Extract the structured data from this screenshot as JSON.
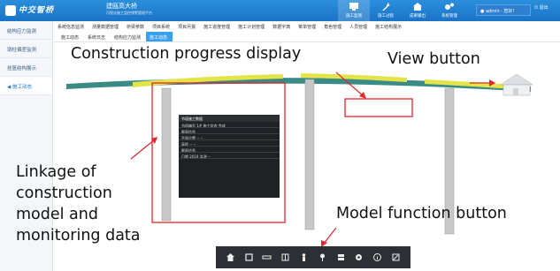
{
  "header": {
    "logo_text": "中交智桥",
    "title": "建瓯高大桥",
    "subtitle": "可视化施工监控预警管理平台",
    "nav": [
      {
        "label": "施工监测",
        "icon": "monitor-icon",
        "active": true
      },
      {
        "label": "施工过程",
        "icon": "wrench-icon",
        "active": false
      },
      {
        "label": "成果输出",
        "icon": "house-icon",
        "active": false
      },
      {
        "label": "系统管理",
        "icon": "gears-icon",
        "active": false
      }
    ],
    "user": "admin · 您好!",
    "exit": "退出"
  },
  "sidebar": {
    "items": [
      {
        "label": "结构应力监测",
        "active": false
      },
      {
        "label": "墩柱偏差监测",
        "active": false
      },
      {
        "label": "挂篮结构展示",
        "active": false
      },
      {
        "label": "◀ 施工动态",
        "active": true
      }
    ]
  },
  "menubar": {
    "items": [
      "系统信息监测",
      "测量数据管理",
      "桥梁参数",
      "项目系统",
      "项目月报",
      "施工进度管理",
      "施工计划管理",
      "数据字典",
      "菜单管理",
      "角色管理",
      "人员管理",
      "施工结构展示"
    ]
  },
  "tabs": [
    {
      "label": "施工动态",
      "active": false
    },
    {
      "label": "系统日志",
      "active": false
    },
    {
      "label": "结构应力监测",
      "active": false
    },
    {
      "label": "施工动态",
      "active": true
    }
  ],
  "annotations": {
    "progress": "Construction progress display",
    "view": "View button",
    "linkage": "Linkage of\nconstruction\nmodel and\nmonitoring data",
    "function": "Model function button"
  },
  "panel": {
    "title": "节段施工数据",
    "rows": [
      "节段编号  1#   施工状态  完成",
      "截面信息",
      "平面位置  --   --",
      "高程  --   --",
      "截面信息",
      "日期  2019   监测   --"
    ]
  },
  "toolbar": {
    "tools": [
      "home-icon",
      "box-icon",
      "ruler-icon",
      "layers-icon",
      "person-icon",
      "pin-icon",
      "grid-icon",
      "gear-icon",
      "info-icon",
      "fullscreen-icon"
    ]
  },
  "colors": {
    "header": "#1b73c8",
    "annotation_red": "#e8232a",
    "deck_teal": "#3a8a86",
    "deck_yellow": "#e3e44a",
    "pier": "#c8c8c8"
  }
}
